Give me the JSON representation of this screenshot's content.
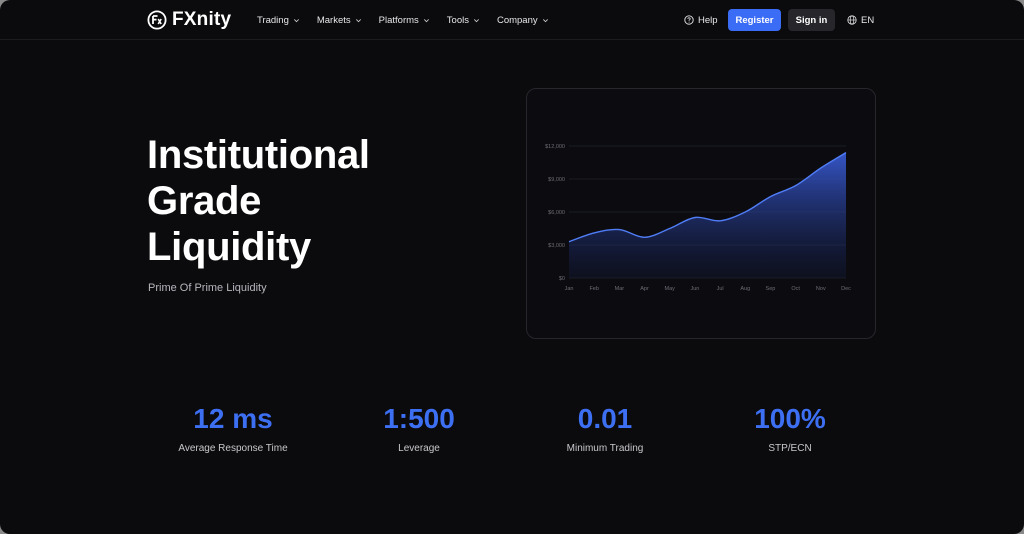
{
  "nav": {
    "brand": "FXnity",
    "menu": [
      {
        "label": "Trading"
      },
      {
        "label": "Markets"
      },
      {
        "label": "Platforms"
      },
      {
        "label": "Tools"
      },
      {
        "label": "Company"
      }
    ],
    "help": "Help",
    "register": "Register",
    "sign_in": "Sign in",
    "language": "EN"
  },
  "hero": {
    "title_lines": [
      "Institutional",
      "Grade",
      "Liquidity"
    ],
    "subtitle": "Prime Of Prime Liquidity"
  },
  "colors": {
    "accent": "#3b6cf6",
    "stat_value": "#3d6ff3",
    "line": "#4f7df7"
  },
  "chart_data": {
    "type": "area",
    "title": "",
    "xlabel": "",
    "ylabel": "",
    "categories": [
      "Jan",
      "Feb",
      "Mar",
      "Apr",
      "May",
      "Jun",
      "Jul",
      "Aug",
      "Sep",
      "Oct",
      "Nov",
      "Dec"
    ],
    "y_tick_labels": [
      "$0",
      "$3,000",
      "$6,000",
      "$9,000",
      "$12,000"
    ],
    "y_ticks": [
      0,
      3000,
      6000,
      9000,
      12000
    ],
    "ylim": [
      0,
      12000
    ],
    "grid": true,
    "legend": "none",
    "series": [
      {
        "values": [
          3300,
          4100,
          4400,
          3700,
          4500,
          5500,
          5200,
          6000,
          7400,
          8400,
          10000,
          11400
        ]
      }
    ]
  },
  "stats": [
    {
      "value": "12 ms",
      "label": "Average Response Time"
    },
    {
      "value": "1:500",
      "label": "Leverage"
    },
    {
      "value": "0.01",
      "label": "Minimum Trading"
    },
    {
      "value": "100%",
      "label": "STP/ECN"
    }
  ]
}
